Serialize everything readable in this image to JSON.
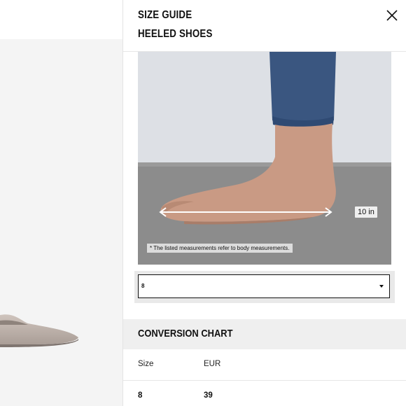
{
  "size_guide": {
    "title": "SIZE GUIDE",
    "subtitle": "HEELED SHOES",
    "close_icon": "close-icon"
  },
  "measurement": {
    "length_label": "10 in",
    "note": "* The listed measurements refer to body measurements."
  },
  "size_selector": {
    "selected": "8",
    "icon": "caret-down-icon"
  },
  "conversion_chart": {
    "title": "CONVERSION CHART",
    "columns": [
      "Size",
      "EUR"
    ],
    "rows": [
      [
        "8",
        "39"
      ]
    ]
  },
  "colors": {
    "panel_bg": "#ffffff",
    "section_bg": "#efefef",
    "text": "#111111",
    "select_border": "#111111"
  }
}
